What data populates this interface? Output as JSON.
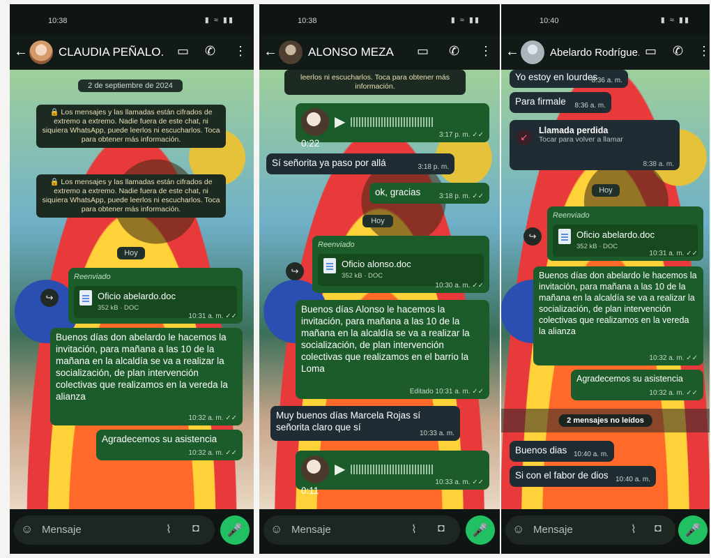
{
  "phone1": {
    "status_time": "10:38",
    "status_icons": "▮ ≈ ▮▮",
    "contact_name": "CLAUDIA PEÑALO...",
    "date_chip": "2 de septiembre de 2024",
    "encryption_notice": "🔒 Los mensajes y las llamadas están cifrados de extremo a extremo. Nadie fuera de este chat, ni siquiera WhatsApp, puede leerlos ni escucharlos. Toca para obtener más información.",
    "today_chip": "Hoy",
    "forwarded_label": "Reenviado",
    "doc_name": "Oficio abelardo.doc",
    "doc_sub": "352 kB · DOC",
    "doc_time": "10:31 a. m. ✓✓",
    "msg_invite": "Buenos días don abelardo le hacemos la invitación, para mañana a las 10 de la mañana en la alcaldía se va a realizar la socialización, de plan intervención colectivas que realizamos en la vereda la alianza",
    "msg_invite_time": "10:32 a. m. ✓✓",
    "msg_thanks": "Agradecemos su asistencia",
    "msg_thanks_time": "10:32 a. m. ✓✓",
    "input_placeholder": "Mensaje"
  },
  "phone2": {
    "status_time": "10:38",
    "status_icons": "▮ ≈ ▮▮",
    "contact_name": "ALONSO MEZA",
    "notice_tail": "leerlos ni escucharlos. Toca para obtener más información.",
    "audio1_duration": "0:22",
    "audio1_time": "3:17 p. m. ✓✓",
    "msg_in1": "Sí señorita ya paso por allá",
    "msg_in1_time": "3:18 p. m.",
    "msg_out1": "ok, gracias",
    "msg_out1_time": "3:18 p. m. ✓✓",
    "today_chip": "Hoy",
    "forwarded_label": "Reenviado",
    "doc_name": "Oficio alonso.doc",
    "doc_sub": "352 kB · DOC",
    "doc_time": "10:30 a. m. ✓✓",
    "msg_invite": "Buenos días Alonso le hacemos la invitación, para mañana a las 10 de la mañana en la alcaldía se va a realizar la socialización, de plan intervención colectivas que realizamos en el barrio la Loma",
    "msg_invite_time": "Editado 10:31 a. m. ✓✓",
    "msg_in2": "Muy buenos días Marcela Rojas sí señorita claro que sí",
    "msg_in2_time": "10:33 a. m.",
    "audio2_duration": "0:11",
    "audio2_time": "10:33 a. m. ✓✓",
    "input_placeholder": "Mensaje"
  },
  "phone3": {
    "status_time": "10:40",
    "status_icons": "▮ ≈ ▮▮",
    "contact_name": "Abelardo Rodrígue...",
    "msg_in1": "Yo estoy en lourdes",
    "msg_in1_time": "8:36 a. m.",
    "msg_in2": "Para firmale",
    "msg_in2_time": "8:36 a. m.",
    "missed_title": "Llamada perdida",
    "missed_sub": "Tocar para volver a llamar",
    "missed_time": "8:38 a. m.",
    "today_chip": "Hoy",
    "forwarded_label": "Reenviado",
    "doc_name": "Oficio abelardo.doc",
    "doc_sub": "352 kB · DOC",
    "doc_time": "10:31 a. m. ✓✓",
    "msg_invite": "Buenos días don abelardo le hacemos la invitación, para mañana a las 10 de la mañana en la alcaldía se va a realizar la socialización, de plan intervención colectivas que realizamos en la vereda la alianza",
    "msg_invite_time": "10:32 a. m. ✓✓",
    "msg_thanks": "Agradecemos su asistencia",
    "msg_thanks_time": "10:32 a. m. ✓✓",
    "unread_chip": "2 mensajes no leídos",
    "msg_in3": "Buenos dias",
    "msg_in3_time": "10:40 a. m.",
    "msg_in4": "Si con el fabor de dios",
    "msg_in4_time": "10:40 a. m.",
    "input_placeholder": "Mensaje"
  },
  "icons": {
    "back": "←",
    "video": "▭",
    "call": "✆",
    "menu": "⋮",
    "emoji": "☺",
    "clip": "⌇",
    "camera": "◘",
    "mic": "🎤",
    "play": "▶",
    "forward": "↪",
    "missed": "↙"
  },
  "colors": {
    "outgoing_bubble": "#1b5c2a",
    "incoming_bubble": "#1f2c33",
    "mic_button": "#21c063",
    "header_bg": "#111a16"
  }
}
